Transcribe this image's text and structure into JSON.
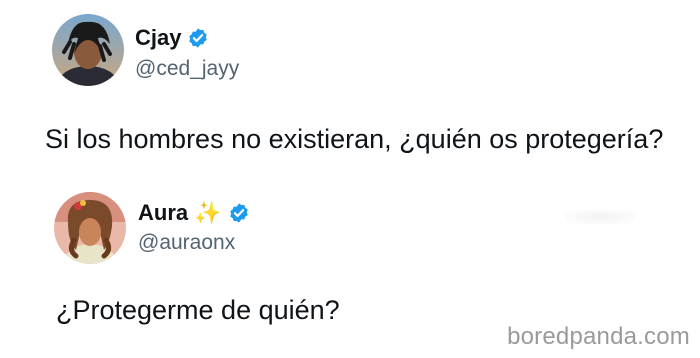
{
  "tweets": [
    {
      "display_name": "Cjay",
      "handle": "@ced_jayy",
      "verified": true,
      "text": "Si los hombres no existieran, ¿quién os protegería?"
    },
    {
      "display_name": "Aura",
      "name_emoji": "✨",
      "handle": "@auraonx",
      "verified": true,
      "text": "¿Protegerme de quién?"
    }
  ],
  "watermark": "boredpanda.com",
  "colors": {
    "verified_blue": "#1d9bf0",
    "handle_gray": "#536471",
    "text": "#0f1419"
  }
}
